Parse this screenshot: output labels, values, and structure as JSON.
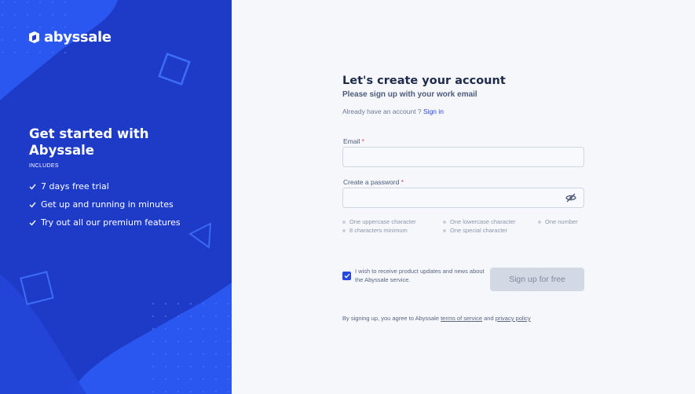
{
  "brand": {
    "name": "abyssale"
  },
  "hero": {
    "title": "Get started with Abyssale",
    "includes_label": "INCLUDES",
    "features": [
      "7 days free trial",
      "Get up and running in minutes",
      "Try out all our premium features"
    ]
  },
  "form": {
    "title": "Let's create your account",
    "subtitle": "Please sign up with your work email",
    "already_text": "Already have an account ? ",
    "signin_link": "Sign in",
    "email_label": "Email",
    "email_value": "",
    "password_label": "Create a password",
    "password_value": "",
    "required_mark": "*",
    "password_rules": [
      "One uppercase character",
      "One lowercase character",
      "One number",
      "8 characters minimum",
      "One special character"
    ],
    "newsletter_label": "I wish to receive product updates and news about the Abyssale service.",
    "newsletter_checked": true,
    "submit_label": "Sign up for free",
    "terms_prefix": "By signing up, you agree to Abyssale ",
    "terms_link": "terms of service",
    "terms_and": " and ",
    "privacy_link": "privacy policy"
  },
  "icons": {
    "eye_toggle": "eye-off-icon",
    "check": "check-icon"
  },
  "colors": {
    "left_panel": "#1e3bc8",
    "accent": "#2448e0",
    "button_disabled": "#d3d9e4",
    "page_bg": "#f5f7fb"
  }
}
